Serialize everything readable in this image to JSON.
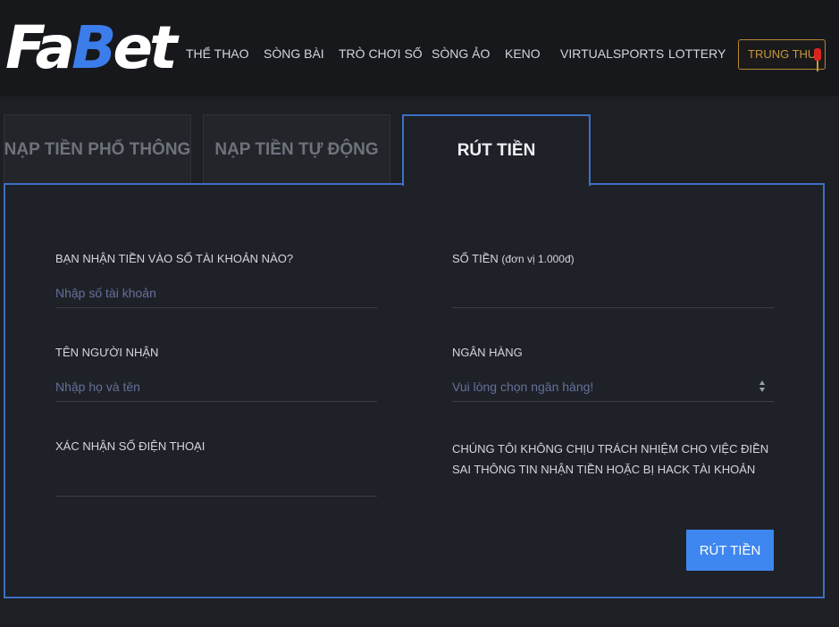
{
  "logo": {
    "part1": "Fa",
    "part2": "B",
    "part3": "et"
  },
  "nav": {
    "items": [
      {
        "label": "THỂ THAO"
      },
      {
        "label": "SÒNG BÀI"
      },
      {
        "label": "TRÒ CHƠI SỐ"
      },
      {
        "label": "SÒNG ẢO"
      },
      {
        "label": "KENO"
      },
      {
        "label": "VIRTUALSPORTS"
      },
      {
        "label": "LOTTERY"
      }
    ],
    "special": "TRUNG THU",
    "special_icon": "lantern-icon",
    "special_color": "#c9973a"
  },
  "tabs": [
    {
      "label": "NẠP TIỀN PHỔ THÔNG"
    },
    {
      "label": "NẠP TIỀN TỰ ĐỘNG"
    },
    {
      "label": "RÚT TIỀN"
    }
  ],
  "form": {
    "account": {
      "label": "BẠN NHẬN TIỀN VÀO SỐ TÀI KHOẢN NÀO?",
      "placeholder": "Nhập số tài khoản",
      "value": ""
    },
    "amount": {
      "label": "SỐ TIỀN",
      "unit": "(đơn vị 1.000đ)",
      "placeholder": "",
      "value": ""
    },
    "recipient": {
      "label": "TÊN NGƯỜI NHẬN",
      "placeholder": "Nhập họ và tên",
      "value": ""
    },
    "bank": {
      "label": "NGÂN HÀNG",
      "selected": "Vui lòng chọn ngân hàng!"
    },
    "phone": {
      "label": "XÁC NHẬN SỐ ĐIỆN THOẠI",
      "placeholder": "",
      "value": ""
    },
    "notice": "CHÚNG TÔI KHÔNG CHỊU TRÁCH NHIỆM CHO VIỆC ĐIỀN SAI THÔNG TIN NHẬN TIỀN HOẶC BỊ HACK TÀI KHOẢN",
    "submit_label": "RÚT TIỀN"
  },
  "colors": {
    "accent": "#3f87f0",
    "border": "#3d6fc4",
    "background": "#1d1f24"
  }
}
